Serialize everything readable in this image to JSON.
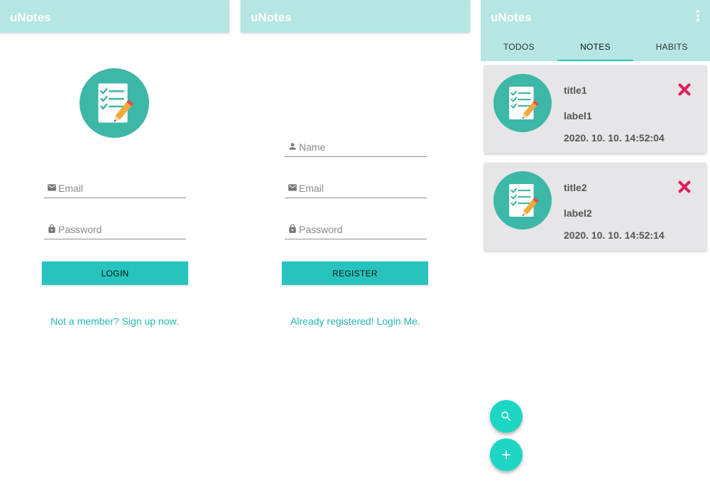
{
  "app": {
    "title": "uNotes"
  },
  "colors": {
    "appbar": "#b5e6e3",
    "accent": "#26c4bd",
    "logo_circle": "#3db7a8",
    "delete": "#e11d5c",
    "fab": "#1ed6c4"
  },
  "login": {
    "email_placeholder": "Email",
    "password_placeholder": "Password",
    "login_button": "LOGIN",
    "signup_link": "Not a member? Sign up now."
  },
  "register": {
    "name_placeholder": "Name",
    "email_placeholder": "Email",
    "password_placeholder": "Password",
    "register_button": "REGISTER",
    "login_link": "Already registered! Login Me."
  },
  "notes": {
    "tabs": [
      {
        "label": "TODOS",
        "active": false
      },
      {
        "label": "NOTES",
        "active": true
      },
      {
        "label": "HABITS",
        "active": false
      }
    ],
    "cards": [
      {
        "title": "title1",
        "label": "label1",
        "date": "2020. 10. 10. 14:52:04"
      },
      {
        "title": "title2",
        "label": "label2",
        "date": "2020. 10. 10. 14:52:14"
      }
    ],
    "icons": {
      "menu": "more-vert-icon",
      "search": "search-icon",
      "add": "plus-icon",
      "delete": "close-icon"
    }
  }
}
